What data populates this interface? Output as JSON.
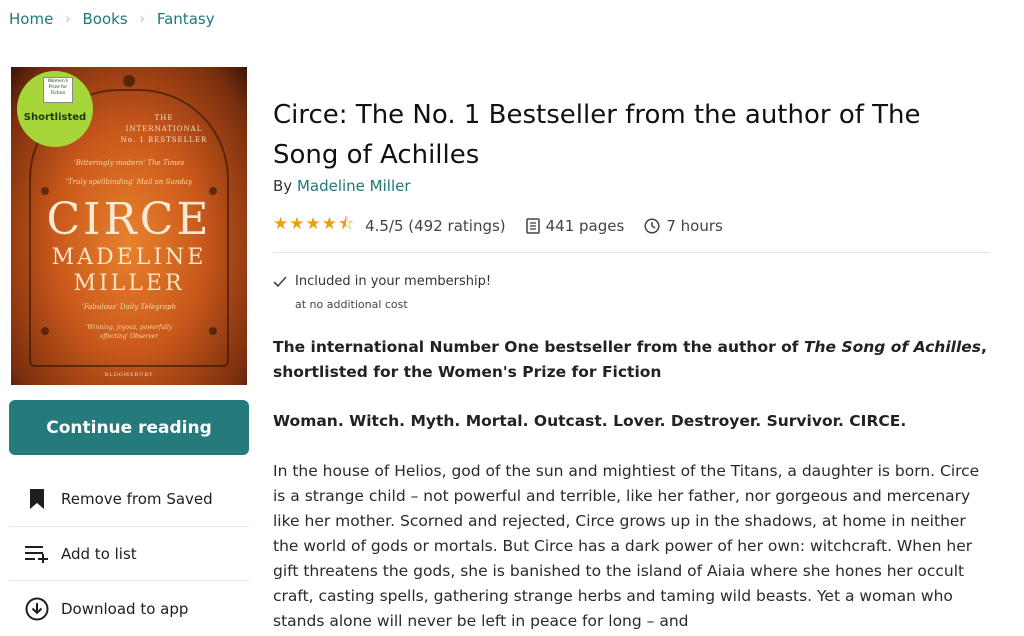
{
  "breadcrumb": {
    "home": "Home",
    "books": "Books",
    "fantasy": "Fantasy",
    "sep": "›"
  },
  "cover": {
    "badge_line1": "Women's Prize for Fiction",
    "badge_main": "Shortlisted",
    "header_small": "THE",
    "header_line2": "INTERNATIONAL",
    "header_line3": "No. 1 BESTSELLER",
    "quote1": "'Bitteringly modern' The Times",
    "quote2": "'Truly spellbinding' Mail on Sunday",
    "title": "CIRCE",
    "author_first": "MADELINE",
    "author_last": "MILLER",
    "quote3": "'Fabulous' Daily Telegraph",
    "quote4": "'Winning, joyous, powerfully affecting' Observer",
    "publisher": "BLOOMSBURY"
  },
  "actions": {
    "continue": "Continue reading",
    "remove_saved": "Remove from Saved",
    "add_list": "Add to list",
    "download": "Download to app"
  },
  "book": {
    "title": "Circe: The No. 1 Bestseller from the author of The Song of Achilles",
    "by": "By",
    "author": "Madeline Miller",
    "stars": "★★★★⯪",
    "rating": 4.5,
    "rating_text": "4.5/5 (492 ratings)",
    "pages": "441 pages",
    "duration": "7 hours"
  },
  "membership": {
    "included": "Included in your membership!",
    "cost": "at no additional cost"
  },
  "description": {
    "p1_before": "The international Number One bestseller from the author of ",
    "p1_italic": "The Song of Achilles",
    "p1_after": ", shortlisted for the Women's Prize for Fiction",
    "p2": "Woman. Witch. Myth. Mortal. Outcast. Lover. Destroyer. Survivor. CIRCE.",
    "p3": "In the house of Helios, god of the sun and mightiest of the Titans, a daughter is born. Circe is a strange child – not powerful and terrible, like her father, nor gorgeous and mercenary like her mother. Scorned and rejected, Circe grows up in the shadows, at home in neither the world of gods or mortals. But Circe has a dark power of her own: witchcraft. When her gift threatens the gods, she is banished to the island of Aiaia where she hones her occult craft, casting spells, gathering strange herbs and taming wild beasts. Yet a woman who stands alone will never be left in peace for long – and"
  },
  "colors": {
    "accent": "#257b7b",
    "link": "#1c7a7a",
    "star": "#e8a210"
  }
}
